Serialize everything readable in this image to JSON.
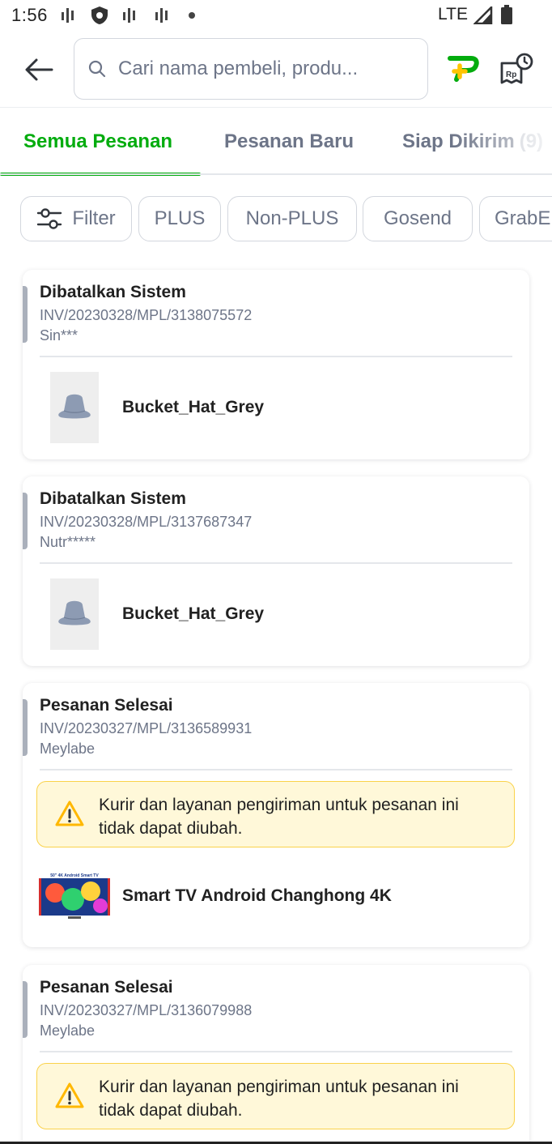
{
  "status_bar": {
    "time": "1:56",
    "network": "LTE"
  },
  "header": {
    "search_placeholder": "Cari nama pembeli, produ..."
  },
  "tabs": [
    {
      "label": "Semua Pesanan",
      "active": true
    },
    {
      "label": "Pesanan Baru",
      "active": false
    },
    {
      "label": "Siap Dikirim",
      "count": "(9)",
      "active": false
    }
  ],
  "filters": [
    {
      "label": "Filter"
    },
    {
      "label": "PLUS"
    },
    {
      "label": "Non-PLUS"
    },
    {
      "label": "Gosend"
    },
    {
      "label": "GrabE"
    }
  ],
  "orders": [
    {
      "status": "Dibatalkan Sistem",
      "invoice": "INV/20230328/MPL/3138075572",
      "buyer": "Sin***",
      "product": "Bucket_Hat_Grey"
    },
    {
      "status": "Dibatalkan Sistem",
      "invoice": "INV/20230328/MPL/3137687347",
      "buyer": "Nutr*****",
      "product": "Bucket_Hat_Grey"
    },
    {
      "status": "Pesanan Selesai",
      "invoice": "INV/20230327/MPL/3136589931",
      "buyer": "Meylabe",
      "warning": "Kurir dan layanan pengiriman untuk pesanan ini tidak dapat diubah.",
      "product": "Smart TV Android Changhong 4K",
      "product_image_caption": "50\" 4K Android Smart TV"
    },
    {
      "status": "Pesanan Selesai",
      "invoice": "INV/20230327/MPL/3136079988",
      "buyer": "Meylabe",
      "warning": "Kurir dan layanan pengiriman untuk pesanan ini tidak dapat diubah."
    }
  ],
  "colors": {
    "accent": "#03ac0e",
    "muted_text": "#6d7588",
    "warning_bg": "#fff8d9",
    "warning_border": "#fad24a"
  }
}
